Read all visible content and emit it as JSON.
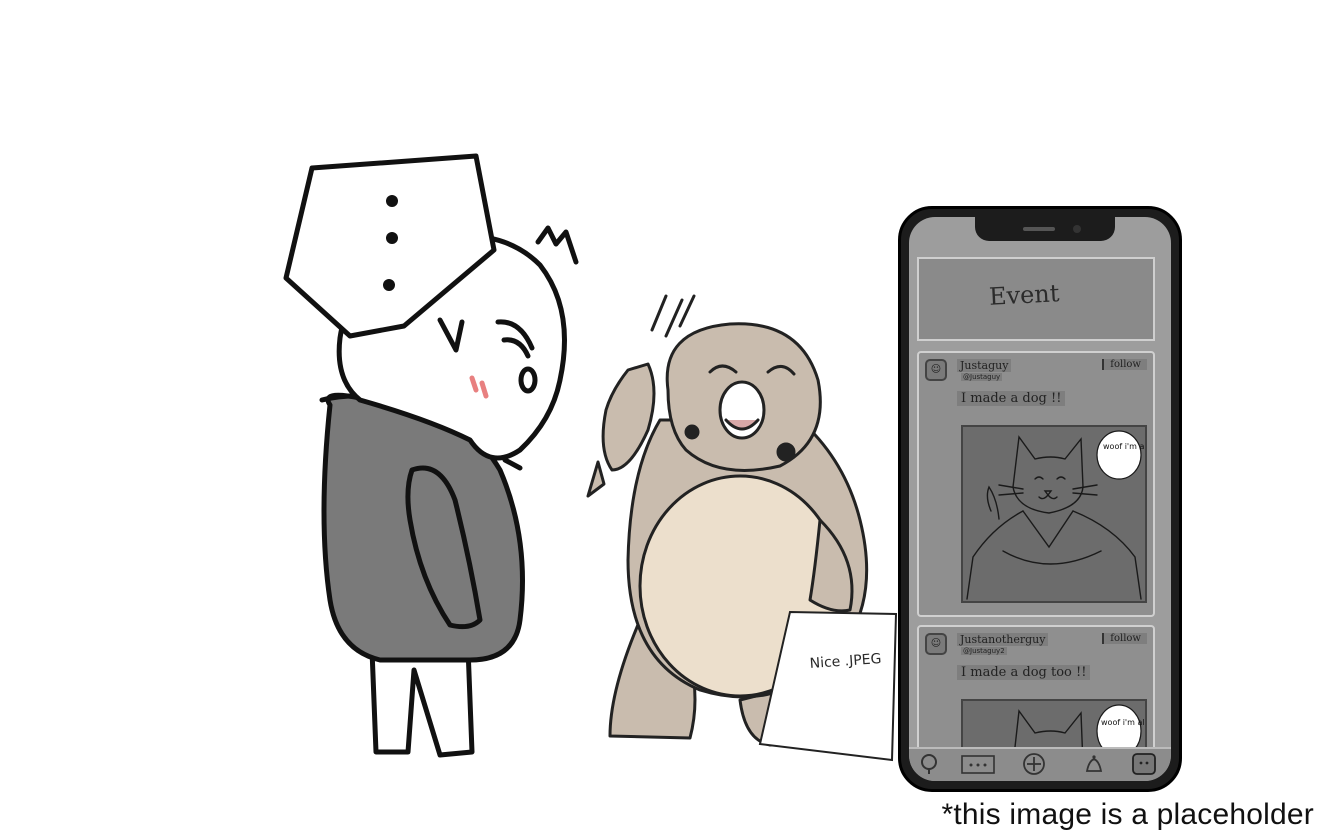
{
  "caption": "*this image is a placeholder",
  "characters": {
    "left": {
      "speech_bubble": "...",
      "mood_mark": "M"
    },
    "middle": {
      "paper_text": "Nice .JPEG"
    }
  },
  "phone": {
    "event_banner": "Event",
    "posts": [
      {
        "username": "Justaguy",
        "handle": "@Justaguy",
        "follow_label": "follow",
        "text": "I made a dog !!",
        "image_bubble": "woof i'm a dog"
      },
      {
        "username": "Justanotherguy",
        "handle": "@Justaguy2",
        "follow_label": "follow",
        "text": "I made a dog too !!",
        "image_bubble": "woof i'm also a dog"
      }
    ],
    "nav_icons": [
      "search-icon",
      "more-icon",
      "add-icon",
      "bell-icon",
      "profile-icon"
    ]
  },
  "colors": {
    "hoodie": "#7a7a7a",
    "seal_body": "#c9bcae",
    "seal_belly": "#ecdfcc",
    "phone_screen": "#9d9d9d",
    "blush": "#e88080"
  }
}
